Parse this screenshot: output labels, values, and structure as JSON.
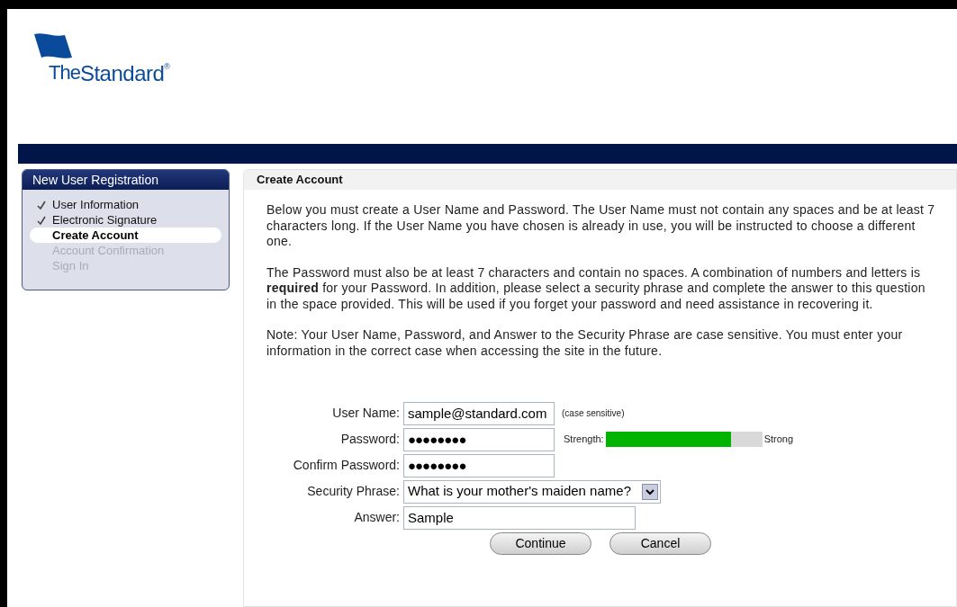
{
  "logo": {
    "prefix": "The",
    "name": "Standard",
    "mark": "®"
  },
  "sidebar": {
    "title": "New User Registration",
    "steps": [
      {
        "label": "User Information",
        "kind": "done"
      },
      {
        "label": "Electronic Signature",
        "kind": "done"
      },
      {
        "label": "Create Account",
        "kind": "current"
      },
      {
        "label": "Account Confirmation",
        "kind": "pending"
      },
      {
        "label": "Sign In",
        "kind": "pending"
      }
    ]
  },
  "panel": {
    "title": "Create Account",
    "paragraphs": [
      "Below you must create a User Name and Password. The User Name must not contain any spaces and be at least 7 characters long. If the User Name you have chosen is already in use, you will be instructed to choose a different one.",
      "The Password must also be at least 7 characters and contain no spaces. A combination of numbers and letters is **required** for your Password. In addition, please select a security phrase and complete the answer to this question in the space provided. This will be used if you forget your password and need assistance in recovering it.",
      "Note: Your User Name, Password, and Answer to the Security Phrase are case sensitive. You must enter your information in the correct case when accessing the site in the future."
    ]
  },
  "form": {
    "fields": [
      {
        "kind": "text",
        "label": "User Name:",
        "value": "sample@standard.com",
        "note": "(case sensitive)"
      },
      {
        "kind": "password",
        "label": "Password:",
        "value": "●●●●●●●●",
        "strength": {
          "label": "Strength:",
          "level": 0.8,
          "reading": "Strong"
        }
      },
      {
        "kind": "password",
        "label": "Confirm Password:",
        "value": "●●●●●●●●"
      },
      {
        "kind": "select",
        "label": "Security Phrase:",
        "value": "What is your mother's maiden name?"
      },
      {
        "kind": "wide",
        "label": "Answer:",
        "value": "Sample"
      }
    ],
    "buttons": [
      "Continue",
      "Cancel"
    ]
  }
}
